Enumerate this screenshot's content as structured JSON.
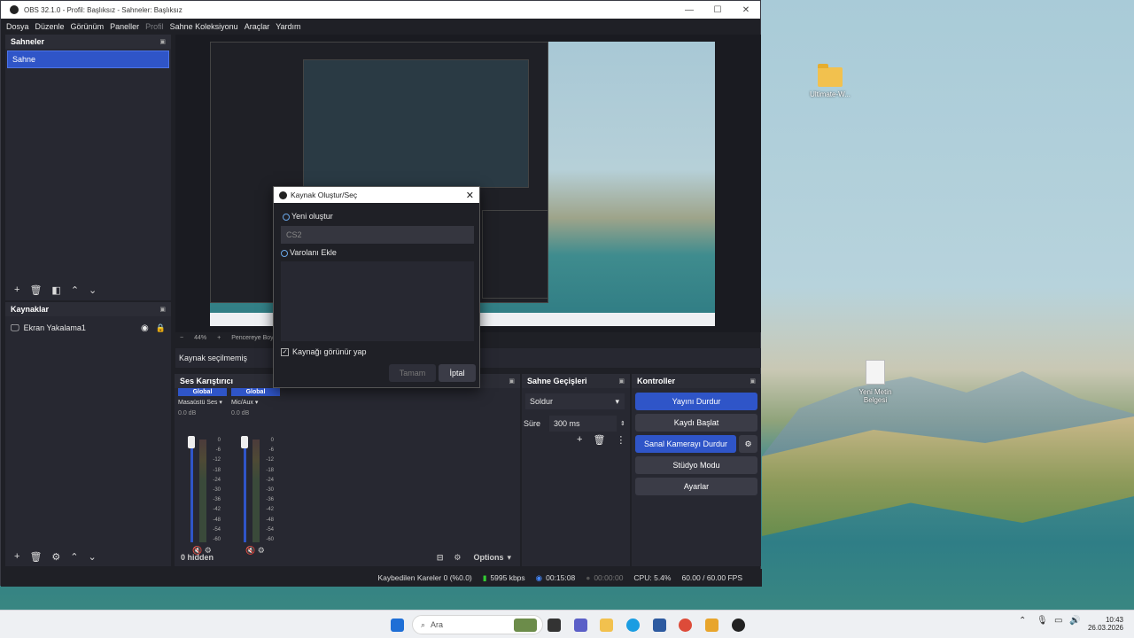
{
  "window": {
    "title": "OBS 32.1.0 - Profil: Başlıksız - Sahneler: Başlıksız",
    "min": "—",
    "max": "☐",
    "close": "✕"
  },
  "menu": [
    "Dosya",
    "Düzenle",
    "Görünüm",
    "Paneller",
    "Profil",
    "Sahne Koleksiyonu",
    "Araçlar",
    "Yardım"
  ],
  "scenes": {
    "title": "Sahneler",
    "item": "Sahne"
  },
  "sources": {
    "title": "Kaynaklar",
    "item": "Ekran Yakalama1"
  },
  "preview": {
    "zoom": "44%",
    "fit": "Pencereye Boyut",
    "no_source": "Kaynak seçilmemiş"
  },
  "mixer": {
    "title": "Ses Karıştırıcı",
    "channels": [
      {
        "global": "Global",
        "name": "Masaüstü Ses",
        "db": "0.0 dB"
      },
      {
        "global": "Global",
        "name": "Mic/Aux",
        "db": "0.0 dB"
      }
    ],
    "scale": [
      "0",
      "-6",
      "-12",
      "-18",
      "-24",
      "-30",
      "-36",
      "-42",
      "-48",
      "-54",
      "-60"
    ],
    "hidden": "0 hidden",
    "options": "Options"
  },
  "transitions": {
    "title": "Sahne Geçişleri",
    "type": "Soldur",
    "duration_label": "Süre",
    "duration": "300 ms"
  },
  "controls": {
    "title": "Kontroller",
    "stop_stream": "Yayını Durdur",
    "start_record": "Kaydı Başlat",
    "stop_vcam": "Sanal Kamerayı Durdur",
    "studio": "Stüdyo Modu",
    "settings": "Ayarlar"
  },
  "status": {
    "dropped": "Kaybedilen Kareler 0 (%0.0)",
    "bitrate": "5995 kbps",
    "stream_time": "00:15:08",
    "rec_time": "00:00:00",
    "cpu": "CPU: 5.4%",
    "fps": "60.00 / 60.00 FPS"
  },
  "dialog": {
    "title": "Kaynak Oluştur/Seç",
    "new": "Yeni oluştur",
    "name": "CS2",
    "existing": "Varolanı Ekle",
    "visible": "Kaynağı görünür yap",
    "ok": "Tamam",
    "cancel": "İptal"
  },
  "desktop": {
    "icon1": "Ultimate-W...",
    "icon2": "Yeni Metin Belgesi"
  },
  "taskbar": {
    "search": "Ara",
    "time": "10:43",
    "date": "26.03.2026"
  }
}
